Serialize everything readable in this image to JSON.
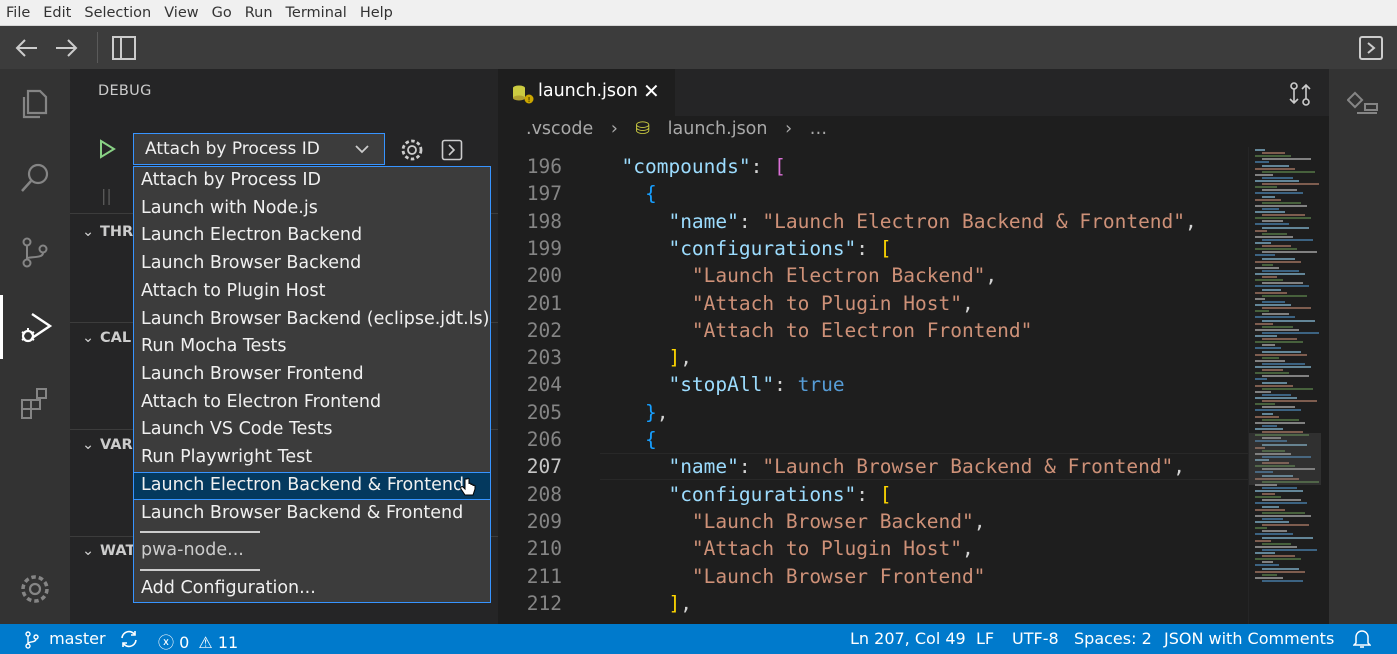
{
  "menu": [
    "File",
    "Edit",
    "Selection",
    "View",
    "Go",
    "Run",
    "Terminal",
    "Help"
  ],
  "sidebar": {
    "title": "DEBUG",
    "selected_config": "Attach by Process ID",
    "sections": [
      "THR",
      "CAL",
      "VAR",
      "WAT"
    ]
  },
  "dropdown": {
    "options": [
      "Attach by Process ID",
      "Launch with Node.js",
      "Launch Electron Backend",
      "Launch Browser Backend",
      "Attach to Plugin Host",
      "Launch Browser Backend (eclipse.jdt.ls)",
      "Run Mocha Tests",
      "Launch Browser Frontend",
      "Attach to Electron Frontend",
      "Launch VS Code Tests",
      "Run Playwright Test",
      "Launch Electron Backend & Frontend",
      "Launch Browser Backend & Frontend"
    ],
    "highlighted": "Launch Electron Backend & Frontend",
    "extra": "pwa-node...",
    "add": "Add Configuration..."
  },
  "editor": {
    "tab_label": "launch.json",
    "breadcrumb": [
      ".vscode",
      "launch.json",
      "…"
    ],
    "lines": [
      {
        "n": "196",
        "t": "  \"compounds\": ["
      },
      {
        "n": "197",
        "t": "    {"
      },
      {
        "n": "198",
        "t": "      \"name\": \"Launch Electron Backend & Frontend\","
      },
      {
        "n": "199",
        "t": "      \"configurations\": ["
      },
      {
        "n": "200",
        "t": "        \"Launch Electron Backend\","
      },
      {
        "n": "201",
        "t": "        \"Attach to Plugin Host\","
      },
      {
        "n": "202",
        "t": "        \"Attach to Electron Frontend\""
      },
      {
        "n": "203",
        "t": "      ],"
      },
      {
        "n": "204",
        "t": "      \"stopAll\": true"
      },
      {
        "n": "205",
        "t": "    },"
      },
      {
        "n": "206",
        "t": "    {"
      },
      {
        "n": "207",
        "t": "      \"name\": \"Launch Browser Backend & Frontend\","
      },
      {
        "n": "208",
        "t": "      \"configurations\": ["
      },
      {
        "n": "209",
        "t": "        \"Launch Browser Backend\","
      },
      {
        "n": "210",
        "t": "        \"Attach to Plugin Host\","
      },
      {
        "n": "211",
        "t": "        \"Launch Browser Frontend\""
      },
      {
        "n": "212",
        "t": "      ],"
      }
    ]
  },
  "status": {
    "branch": "master",
    "errors": "0",
    "warnings": "11",
    "position": "Ln 207, Col 49",
    "eol": "LF",
    "encoding": "UTF-8",
    "spaces": "Spaces: 2",
    "language": "JSON with Comments"
  }
}
